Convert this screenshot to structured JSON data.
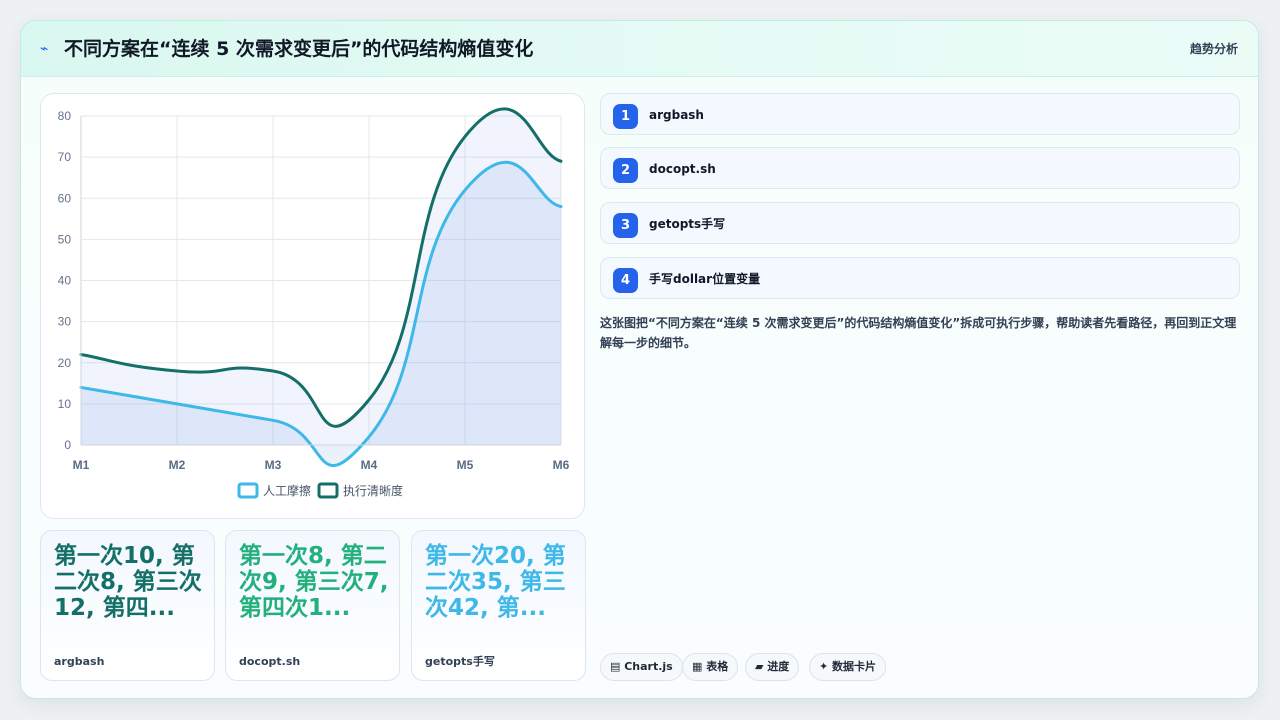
{
  "header": {
    "icon": "trend-icon",
    "title": "不同方案在“连续 5 次需求变更后”的代码结构熵值变化",
    "tag": "趋势分析"
  },
  "chart_data": {
    "type": "line",
    "x": [
      "M1",
      "M2",
      "M3",
      "M4",
      "M5",
      "M6"
    ],
    "ylim": [
      0,
      80
    ],
    "yticks": [
      0,
      10,
      20,
      30,
      40,
      50,
      60,
      70,
      80
    ],
    "grid": true,
    "legend_position": "bottom",
    "series": [
      {
        "name": "人工摩擦",
        "values": [
          14,
          10,
          6,
          2,
          62,
          58
        ],
        "color": "#3db8e8",
        "fill": true
      },
      {
        "name": "执行清晰度",
        "values": [
          22,
          18,
          18,
          11,
          75,
          69
        ],
        "color": "#136f67",
        "fill": true
      }
    ]
  },
  "stats": [
    {
      "value": "第一次10, 第二次8, 第三次12, 第四...",
      "label": "argbash",
      "color": "#136f67"
    },
    {
      "value": "第一次8, 第二次9, 第三次7, 第四次1...",
      "label": "docopt.sh",
      "color": "#22b07d"
    },
    {
      "value": "第一次20, 第二次35, 第三次42, 第...",
      "label": "getopts手写",
      "color": "#3db8e8"
    }
  ],
  "steps": [
    {
      "num": "1",
      "name": "argbash"
    },
    {
      "num": "2",
      "name": "docopt.sh"
    },
    {
      "num": "3",
      "name": "getopts手写"
    },
    {
      "num": "4",
      "name": "手写dollar位置变量"
    }
  ],
  "description": "这张图把“不同方案在“连续 5 次需求变更后”的代码结构熵值变化”拆成可执行步骤，帮助读者先看路径，再回到正文理解每一步的细节。",
  "chips": [
    {
      "icon": "chart-icon",
      "label": "▤ Chart.js"
    },
    {
      "icon": "table-icon",
      "label": "▦ 表格"
    },
    {
      "icon": "progress-icon",
      "label": "▰ 进度"
    },
    {
      "icon": "sparkle-icon",
      "label": "✦ 数据卡片"
    }
  ]
}
